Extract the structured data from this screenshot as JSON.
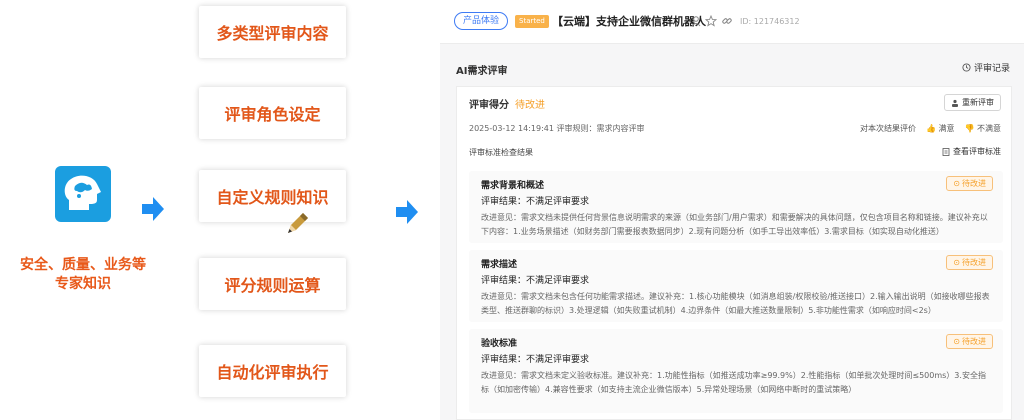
{
  "expert": {
    "label_line1": "安全、质量、业务等",
    "label_line2": "专家知识"
  },
  "features": [
    "多类型评审内容",
    "评审角色设定",
    "自定义规则知识",
    "评分规则运算",
    "自动化评审执行"
  ],
  "panel": {
    "product_tag": "产品体验",
    "status_tag": "Started",
    "title": "【云端】支持企业微信群机器人",
    "id": "ID: 121746312",
    "section_title": "AI需求评审",
    "record_label": "评审记录",
    "score_label": "评审得分",
    "score_value": "待改进",
    "rereview_label": "重新评审",
    "meta": "2025-03-12 14:19:41  评审规则：需求内容评审",
    "feedback_prompt": "对本次结果评价",
    "like_label": "满意",
    "dislike_label": "不满意",
    "check_title": "评审标准检查结果",
    "view_standard": "查看评审标准",
    "items": [
      {
        "name": "需求背景和概述",
        "verdict": "评审结果：不满足评审要求",
        "advice": "改进意见：需求文档未提供任何背景信息说明需求的来源（如业务部门/用户需求）和需要解决的具体问题，仅包含项目名称和链接。建议补充以下内容：1.业务场景描述（如财务部门需要报表数据同步）2.现有问题分析（如手工导出效率低）3.需求目标（如实现自动化推送）",
        "badge": "待改进"
      },
      {
        "name": "需求描述",
        "verdict": "评审结果：不满足评审要求",
        "advice": "改进意见：需求文档未包含任何功能需求描述。建议补充：1.核心功能模块（如消息组装/权限校验/推送接口）2.输入输出说明（如接收哪些报表类型、推送群聊的标识）3.处理逻辑（如失败重试机制）4.边界条件（如最大推送数量限制）5.非功能性需求（如响应时间<2s）",
        "badge": "待改进"
      },
      {
        "name": "验收标准",
        "verdict": "评审结果：不满足评审要求",
        "advice": "改进意见：需求文档未定义验收标准。建议补充：1.功能性指标（如推送成功率≥99.9%）2.性能指标（如单批次处理时间≤500ms）3.安全指标（如加密传输）4.兼容性要求（如支持主流企业微信版本）5.异常处理场景（如网络中断时的重试策略）",
        "badge": "待改进"
      }
    ]
  },
  "colors": {
    "accent_orange": "#e2571a",
    "arrow_blue": "#1f8ef1",
    "head_blue": "#1b9ee0",
    "pending": "#f5a02a",
    "link_blue": "#3e7bf4"
  }
}
